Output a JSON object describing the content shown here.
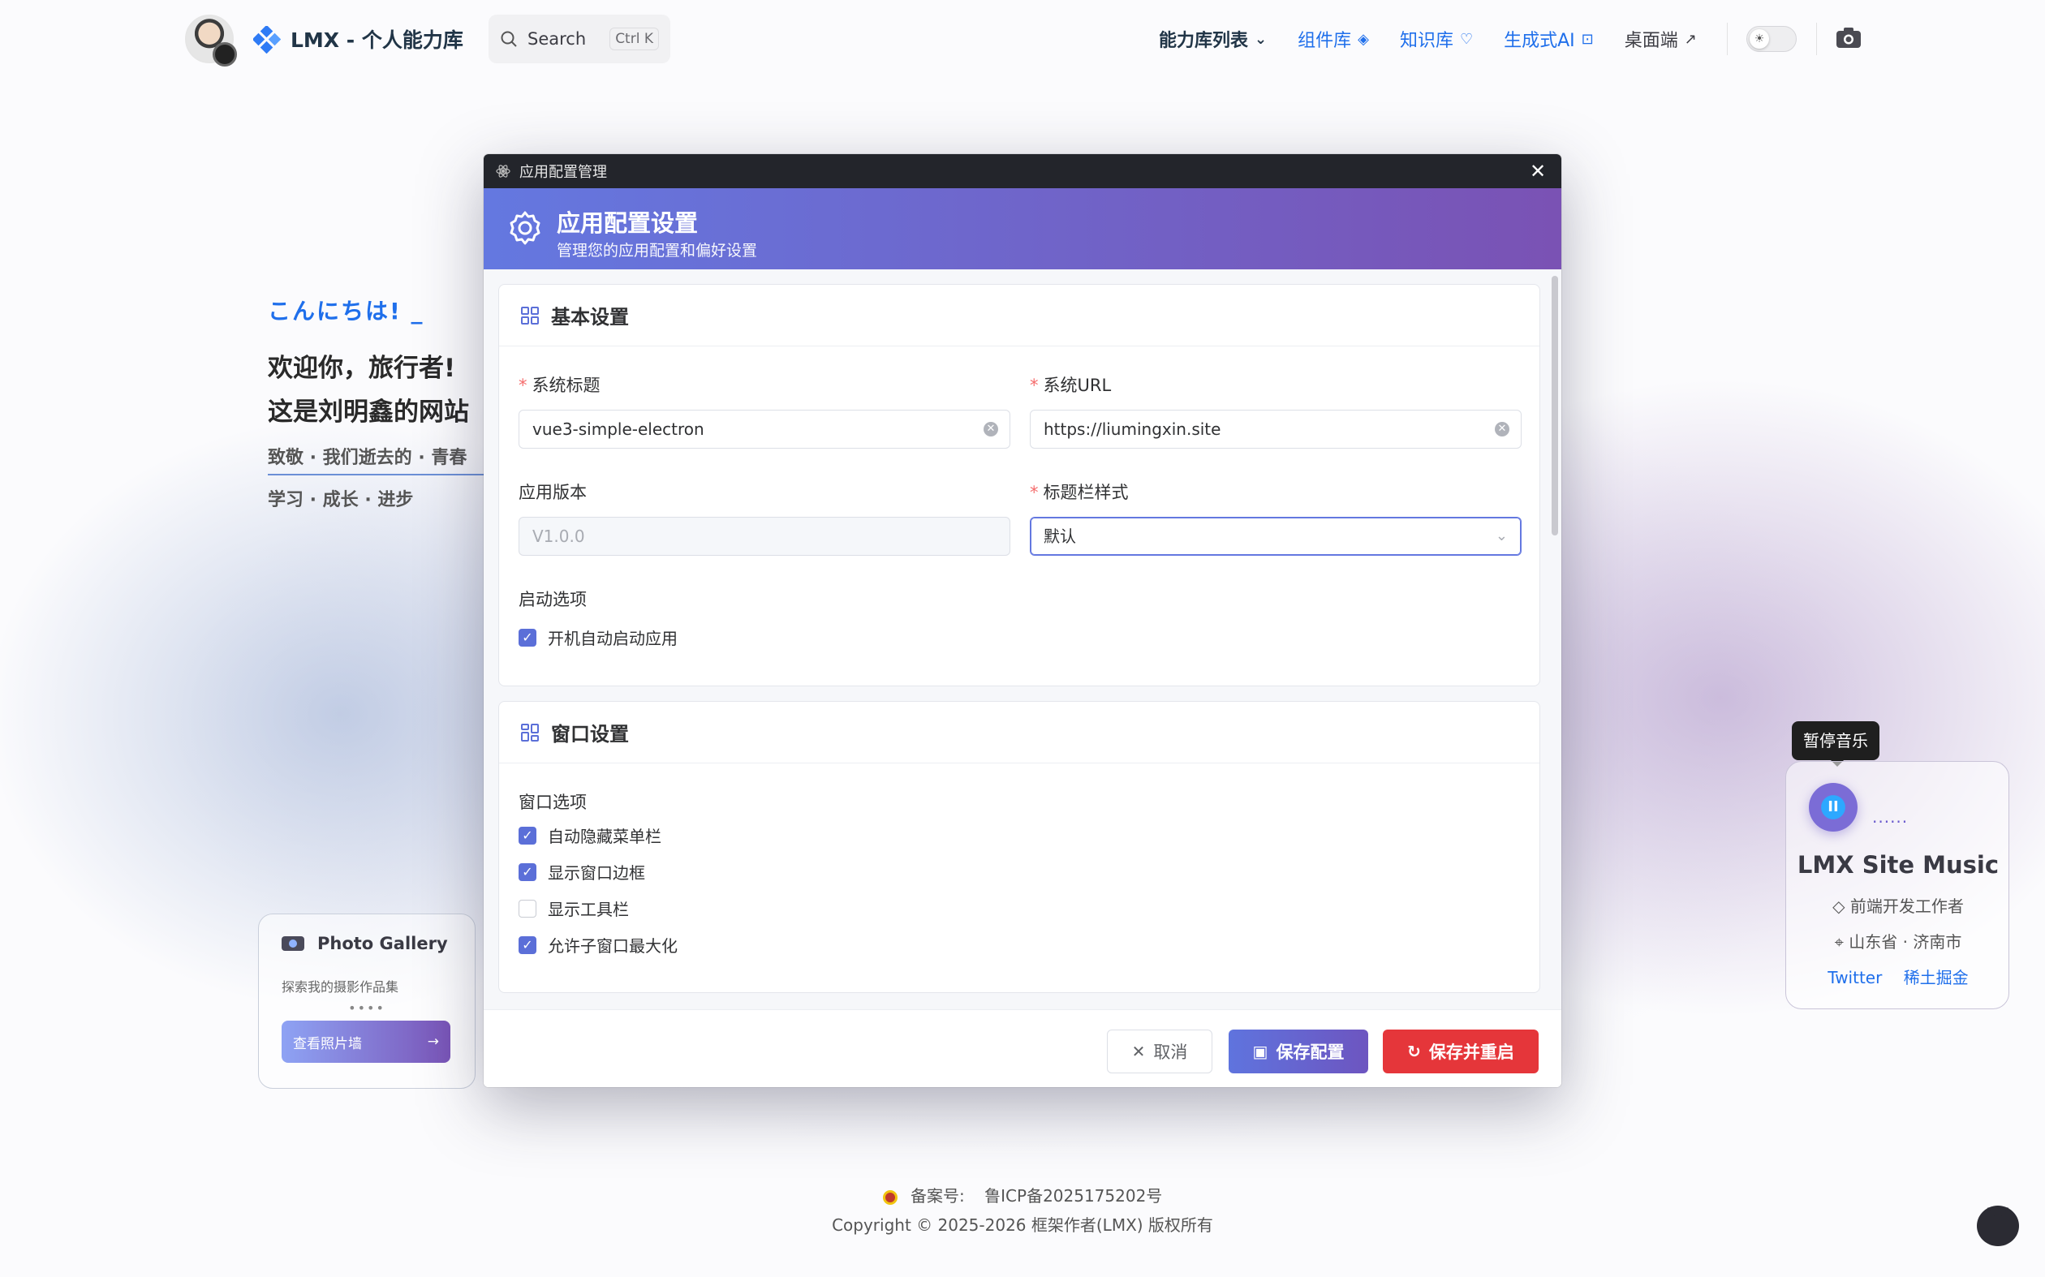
{
  "nav": {
    "site_title": "LMX - 个人能力库",
    "search_label": "Search",
    "search_shortcut": "Ctrl K",
    "links": [
      {
        "label": "能力库列表",
        "icon": "⌄"
      },
      {
        "label": "组件库",
        "icon": "◈"
      },
      {
        "label": "知识库",
        "icon": "♡"
      },
      {
        "label": "生成式AI",
        "icon": "⊡"
      },
      {
        "label": "桌面端",
        "icon": "↗"
      }
    ],
    "theme_toggle_icon": "sun-icon",
    "accent_color": "#1f6feb"
  },
  "hero": {
    "greeting": "こんにちは! _",
    "welcome_line1": "欢迎你，旅行者!",
    "welcome_line2": "这是刘明鑫的网站",
    "tagline1": "致敬 · 我们逝去的 · 青春",
    "tagline2": "学习 · 成长 · 进步"
  },
  "gallery": {
    "title": "Photo Gallery",
    "subtitle": "探索我的摄影作品集",
    "dots": "••••",
    "button_label": "查看照片墙",
    "button_arrow": "→"
  },
  "music": {
    "tooltip": "暂停音乐",
    "play_glyph": "II",
    "wave": "......",
    "title": "LMX Site Music",
    "role": "前端开发工作者",
    "location": "山东省 · 济南市",
    "links": [
      "Twitter",
      "稀土掘金"
    ]
  },
  "footer": {
    "icp_label": "备案号:",
    "icp_value": "鲁ICP备2025175202号",
    "copyright": "Copyright © 2025-2026 框架作者(LMX) 版权所有"
  },
  "modal": {
    "window_title": "应用配置管理",
    "close_glyph": "✕",
    "header_title": "应用配置设置",
    "header_subtitle": "管理您的应用配置和偏好设置",
    "gradient": [
      "#6478e0",
      "#7a52b4"
    ],
    "basic": {
      "title": "基本设置",
      "system_title_label": "系统标题",
      "system_title_value": "vue3-simple-electron",
      "system_url_label": "系统URL",
      "system_url_value": "https://liumingxin.site",
      "version_label": "应用版本",
      "version_placeholder": "V1.0.0",
      "titlebar_style_label": "标题栏样式",
      "titlebar_style_value": "默认",
      "startup_label": "启动选项",
      "startup_options": [
        {
          "label": "开机自动启动应用",
          "checked": true
        }
      ]
    },
    "window": {
      "title": "窗口设置",
      "options_label": "窗口选项",
      "options": [
        {
          "label": "自动隐藏菜单栏",
          "checked": true
        },
        {
          "label": "显示窗口边框",
          "checked": true
        },
        {
          "label": "显示工具栏",
          "checked": false
        },
        {
          "label": "允许子窗口最大化",
          "checked": true
        }
      ]
    },
    "buttons": {
      "cancel": "取消",
      "save": "保存配置",
      "save_restart": "保存并重启"
    },
    "danger_color": "#e5363a"
  }
}
